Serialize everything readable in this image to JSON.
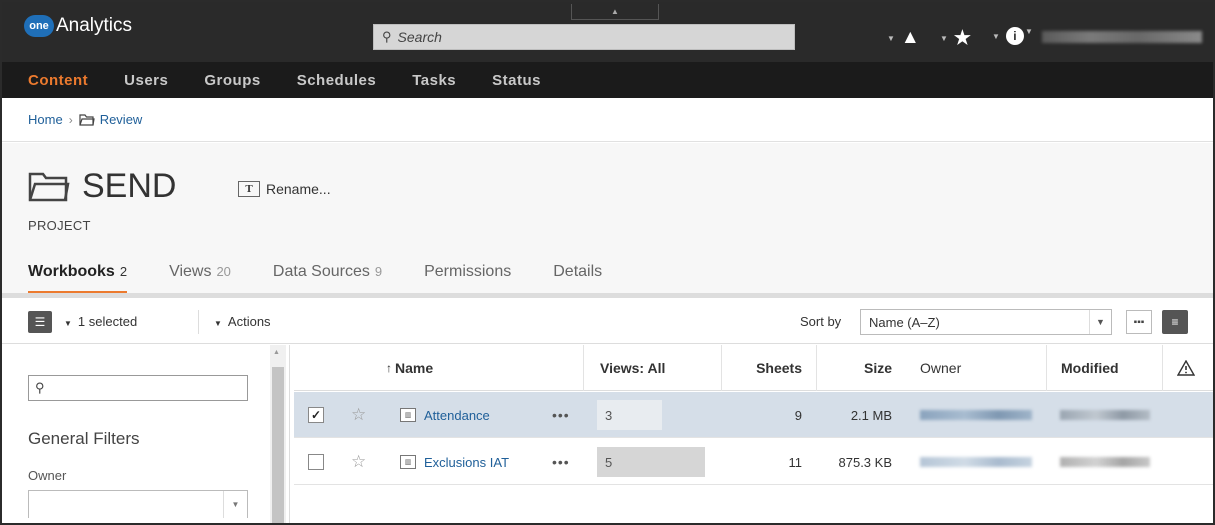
{
  "app": {
    "logo_badge": "one",
    "logo_text": "Analytics"
  },
  "search": {
    "placeholder": "Search"
  },
  "topbar_icons": [
    "alert-icon",
    "favorites-star-icon",
    "info-icon"
  ],
  "nav": {
    "items": [
      "Content",
      "Users",
      "Groups",
      "Schedules",
      "Tasks",
      "Status"
    ],
    "active": "Content"
  },
  "breadcrumb": {
    "home": "Home",
    "current": "Review"
  },
  "project": {
    "title": "SEND",
    "rename_label": "Rename...",
    "type": "PROJECT"
  },
  "tabs": [
    {
      "label": "Workbooks",
      "count": "2",
      "active": true
    },
    {
      "label": "Views",
      "count": "20"
    },
    {
      "label": "Data Sources",
      "count": "9"
    },
    {
      "label": "Permissions",
      "count": ""
    },
    {
      "label": "Details",
      "count": ""
    }
  ],
  "toolbar": {
    "selected_label": "1 selected",
    "actions_label": "Actions",
    "sort_by_label": "Sort by",
    "sort_value": "Name (A–Z)"
  },
  "filters": {
    "search_value": "",
    "general_filters_label": "General Filters",
    "owner_label": "Owner"
  },
  "table": {
    "columns": [
      "Name",
      "Views: All",
      "Sheets",
      "Size",
      "Owner",
      "Modified"
    ],
    "sort_indicator": "↑",
    "rows": [
      {
        "name": "Attendance",
        "views": "3",
        "views_fraction": 0.6,
        "sheets": "9",
        "size": "2.1 MB",
        "selected": true
      },
      {
        "name": "Exclusions IAT",
        "views": "5",
        "views_fraction": 1.0,
        "sheets": "11",
        "size": "875.3 KB",
        "selected": false
      }
    ]
  },
  "colors": {
    "accent": "#ec7a2e",
    "link": "#1f5f99",
    "topbar": "#2a2a2a",
    "nav": "#1b1b1b",
    "selected_row": "#d5dee8"
  }
}
